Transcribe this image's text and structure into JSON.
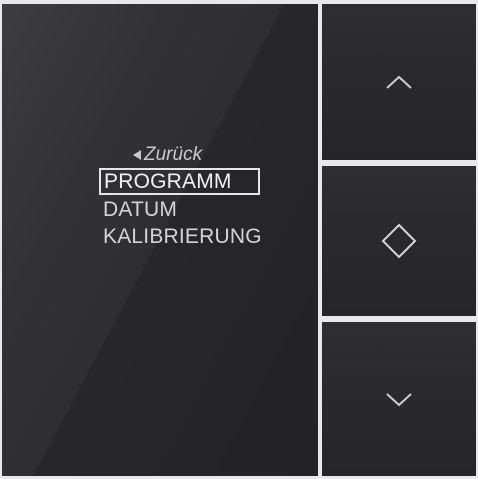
{
  "menu": {
    "back_label": "Zurück",
    "items": [
      {
        "label": "PROGRAMM",
        "selected": true
      },
      {
        "label": "DATUM",
        "selected": false
      },
      {
        "label": "KALIBRIERUNG",
        "selected": false
      }
    ]
  },
  "buttons": {
    "up_icon": "chevron-up-icon",
    "ok_icon": "diamond-icon",
    "down_icon": "chevron-down-icon"
  },
  "colors": {
    "panel": "#27272a",
    "text": "#d4d4d4",
    "selection_border": "#e6e6e6"
  }
}
